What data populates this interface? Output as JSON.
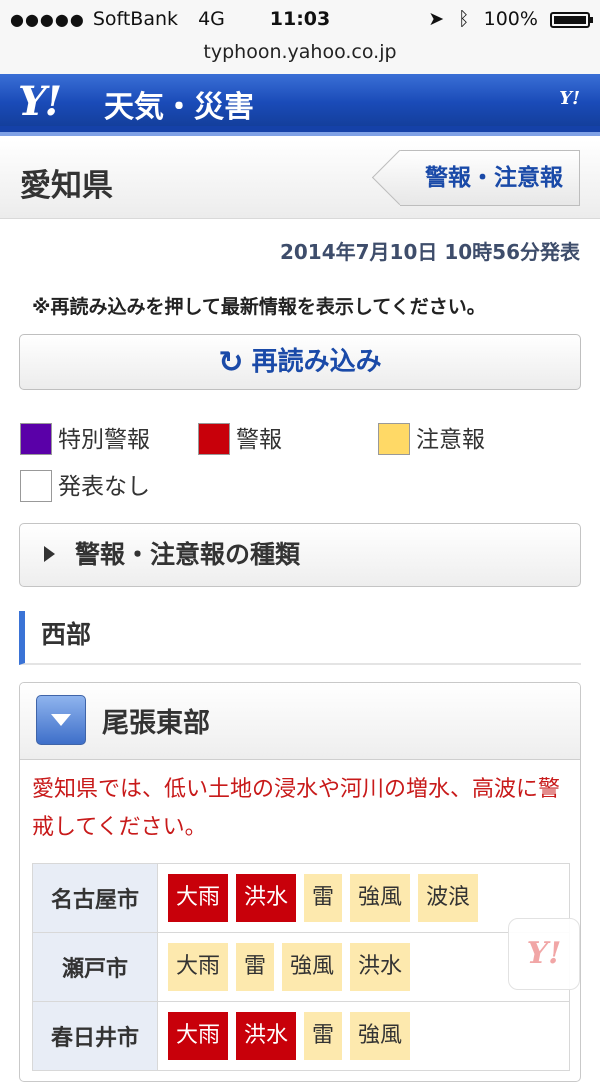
{
  "status": {
    "carrier": "SoftBank",
    "network": "4G",
    "time": "11:03",
    "battery": "100%"
  },
  "browser": {
    "url": "typhoon.yahoo.co.jp"
  },
  "header": {
    "logo": "Y!",
    "title": "天気・災害",
    "small_logo": "Y!"
  },
  "prefecture": {
    "name": "愛知県",
    "alert_button": "警報・注意報"
  },
  "published": "2014年7月10日 10時56分発表",
  "notice": "※再読み込みを押して最新情報を表示してください。",
  "reload_label": "再読み込み",
  "legend": [
    {
      "label": "特別警報",
      "color": "#5a00a8"
    },
    {
      "label": "警報",
      "color": "#c8000a"
    },
    {
      "label": "注意報",
      "color": "#ffd966"
    },
    {
      "label": "発表なし",
      "color": "#ffffff"
    }
  ],
  "types_label": "警報・注意報の種類",
  "region": {
    "name": "西部",
    "subregion": "尾張東部",
    "warning_text": "愛知県では、低い土地の浸水や河川の増水、高波に警戒してください。",
    "cities": [
      {
        "name": "名古屋市",
        "tags": [
          {
            "label": "大雨",
            "level": "警報"
          },
          {
            "label": "洪水",
            "level": "警報"
          },
          {
            "label": "雷",
            "level": "注意報"
          },
          {
            "label": "強風",
            "level": "注意報"
          },
          {
            "label": "波浪",
            "level": "注意報"
          }
        ]
      },
      {
        "name": "瀬戸市",
        "tags": [
          {
            "label": "大雨",
            "level": "注意報"
          },
          {
            "label": "雷",
            "level": "注意報"
          },
          {
            "label": "強風",
            "level": "注意報"
          },
          {
            "label": "洪水",
            "level": "注意報"
          }
        ]
      },
      {
        "name": "春日井市",
        "tags": [
          {
            "label": "大雨",
            "level": "警報"
          },
          {
            "label": "洪水",
            "level": "警報"
          },
          {
            "label": "雷",
            "level": "注意報"
          },
          {
            "label": "強風",
            "level": "注意報"
          }
        ]
      }
    ]
  },
  "floating_logo": "Y!"
}
